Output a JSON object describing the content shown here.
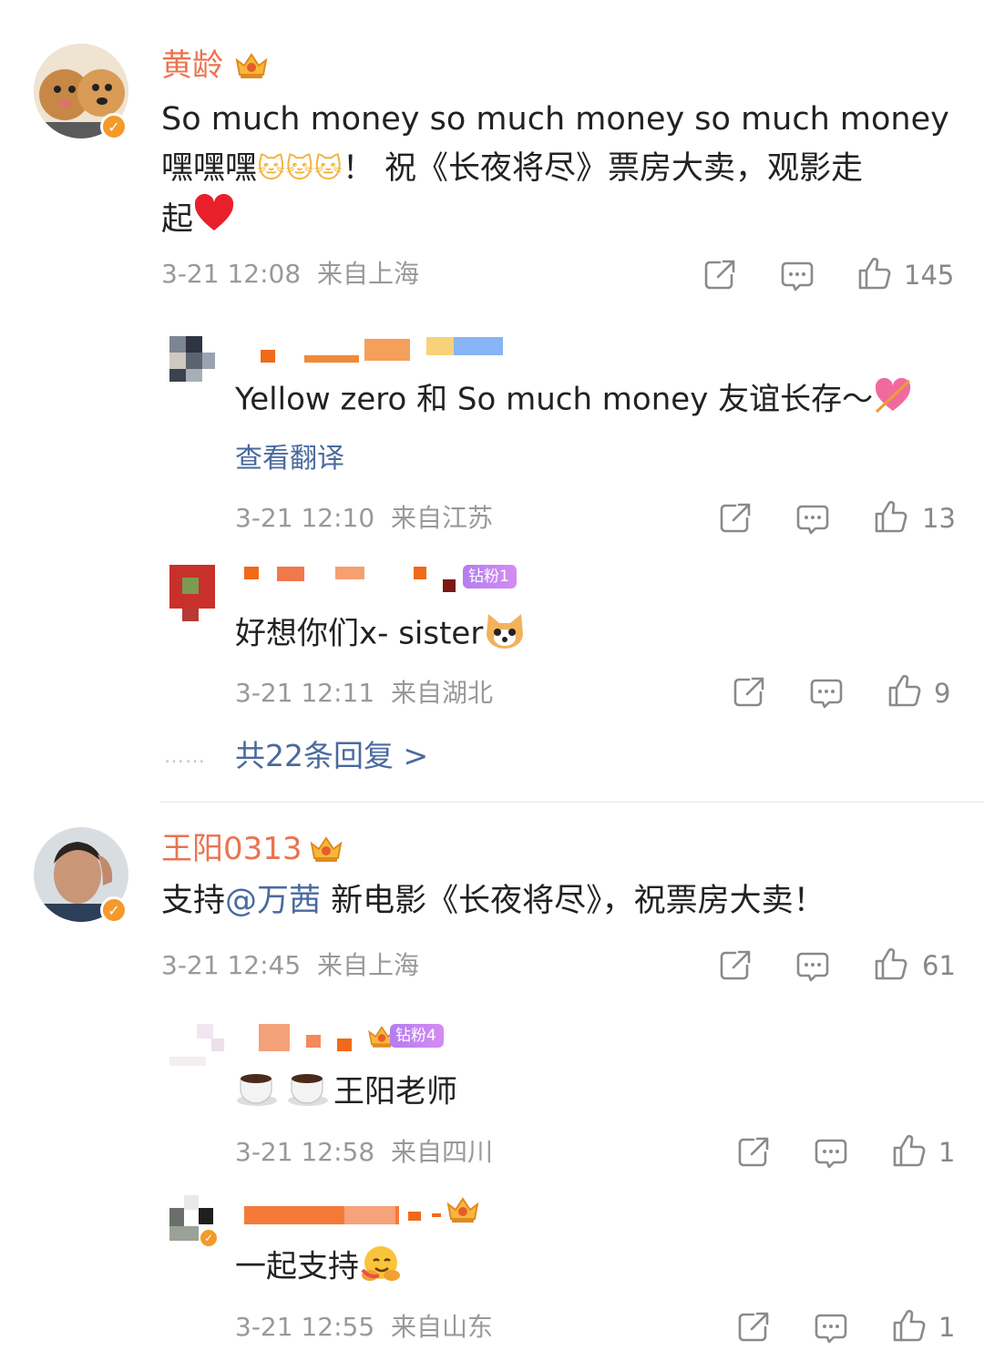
{
  "comments": [
    {
      "username": "黄龄",
      "text_line1": "So much money so much money so much money",
      "text_line2a": "嘿嘿嘿",
      "text_line2b": "！ 祝《长夜将尽》票房大卖，观影走",
      "text_line3": "起",
      "time": "3-21 12:08",
      "location": "来自上海",
      "likes": "145",
      "replies": [
        {
          "username": "",
          "text": "Yellow zero 和 So much money 友谊长存～",
          "translate_link": "查看翻译",
          "time": "3-21 12:10",
          "location": "来自江苏",
          "likes": "13"
        },
        {
          "username": "",
          "badge": "钻粉1",
          "text": "好想你们x- sister",
          "time": "3-21 12:11",
          "location": "来自湖北",
          "likes": "9"
        }
      ],
      "more_replies": "共22条回复 >",
      "more_dots": "……"
    },
    {
      "username": "王阳0313",
      "text_prefix": "支持",
      "mention": "@万茜",
      "text_suffix": " 新电影《长夜将尽》，祝票房大卖！",
      "time": "3-21 12:45",
      "location": "来自上海",
      "likes": "61",
      "replies": [
        {
          "username": "",
          "badge": "钻粉4",
          "text": "王阳老师",
          "time": "3-21 12:58",
          "location": "来自四川",
          "likes": "1"
        },
        {
          "username": "",
          "text": "一起支持",
          "time": "3-21 12:55",
          "location": "来自山东",
          "likes": "1"
        }
      ]
    }
  ],
  "colors": {
    "username": "#eb7350",
    "link": "#4a6a9e",
    "meta": "#999999",
    "verified": "#f39a2b"
  },
  "icons": [
    "share-icon",
    "comment-icon",
    "like-icon",
    "crown-icon",
    "verified-icon"
  ]
}
